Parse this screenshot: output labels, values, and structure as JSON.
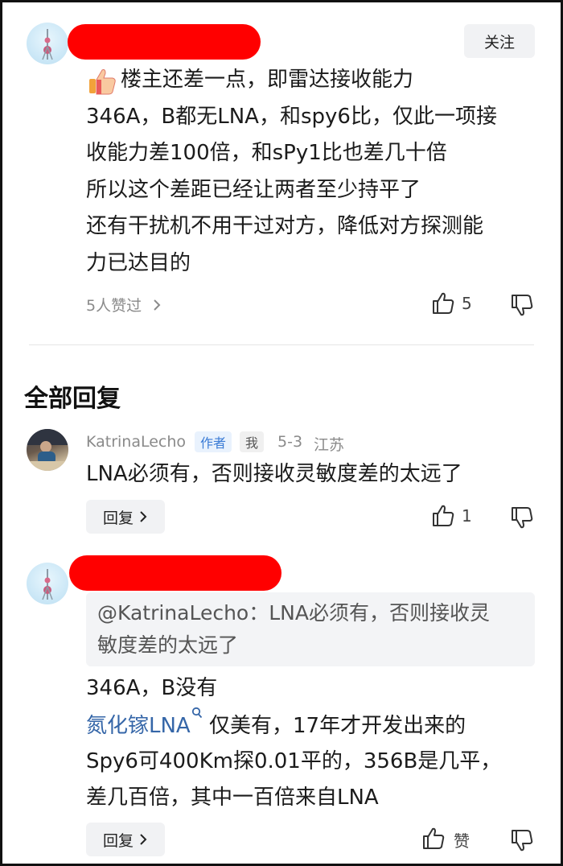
{
  "main_comment": {
    "follow_label": "关注",
    "emoji": "thumbs-up-emoji",
    "lines": [
      "楼主还差一点，即雷达接收能力",
      "346A，B都无LNA，和spy6比，仅此一项接",
      "收能力差100倍，和sPy1比也差几十倍",
      "所以这个差距已经让两者至少持平了",
      "还有干扰机不用干过对方，降低对方探测能",
      "力已达目的"
    ],
    "liked_by": "5人赞过",
    "like_count": "5"
  },
  "replies_header": "全部回复",
  "reply1": {
    "username": "KatrinaLecho",
    "author_tag": "作者",
    "me_tag": "我",
    "date": "5-3",
    "location": "江苏",
    "text": "LNA必须有，否则接收灵敏度差的太远了",
    "reply_label": "回复",
    "like_count": "1"
  },
  "reply2": {
    "quote_line1": "@KatrinaLecho：LNA必须有，否则接收灵",
    "quote_line2": "敏度差的太远了",
    "line1": "346A，B没有",
    "link_text": "氮化镓LNA",
    "line2_rest": " 仅美有，17年才开发出来的",
    "line3": "Spy6可400Km探0.01平的，356B是几平，",
    "line4": "差几百倍，其中一百倍来自LNA",
    "reply_label": "回复",
    "like_label": "赞"
  },
  "colors": {
    "redaction": "#ff0000",
    "link": "#3566a8",
    "author_tag": "#3a7bd5"
  }
}
